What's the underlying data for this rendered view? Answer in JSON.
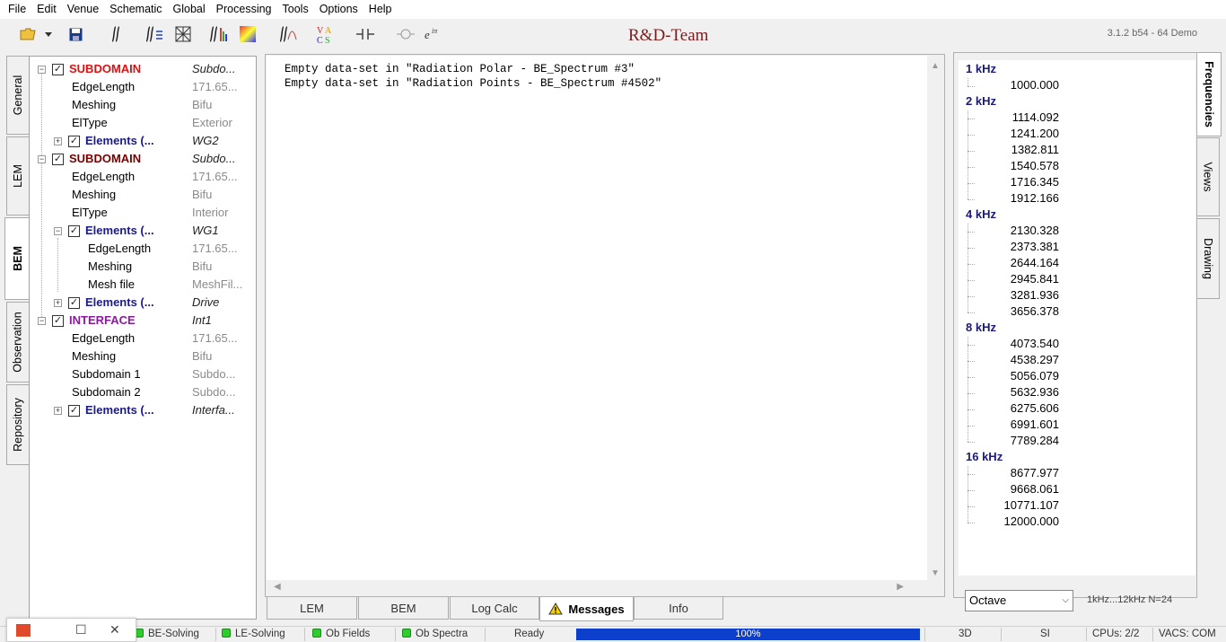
{
  "menu": [
    "File",
    "Edit",
    "Venue",
    "Schematic",
    "Global",
    "Processing",
    "Tools",
    "Options",
    "Help"
  ],
  "toolbar": {
    "app_title": "R&D-Team",
    "version": "3.1.2 b54 - 64 Demo",
    "vacs_label": "VA\nCS",
    "exp_label": "e^iπ"
  },
  "left_tabs": [
    "General",
    "LEM",
    "BEM",
    "Observation",
    "Repository"
  ],
  "right_tabs": [
    "Frequencies",
    "Views",
    "Drawing"
  ],
  "tree": [
    {
      "label": "SUBDOMAIN",
      "value": "Subdo...",
      "style": "subdomain"
    },
    {
      "label": "EdgeLength",
      "value": "171.65..."
    },
    {
      "label": "Meshing",
      "value": "Bifu"
    },
    {
      "label": "ElType",
      "value": "Exterior"
    },
    {
      "label": "Elements (...",
      "value": "WG2",
      "style": "elements"
    },
    {
      "label": "SUBDOMAIN",
      "value": "Subdo...",
      "style": "subdomain2"
    },
    {
      "label": "EdgeLength",
      "value": "171.65..."
    },
    {
      "label": "Meshing",
      "value": "Bifu"
    },
    {
      "label": "ElType",
      "value": "Interior"
    },
    {
      "label": "Elements (...",
      "value": "WG1",
      "style": "elements"
    },
    {
      "label": "EdgeLength",
      "value": "171.65..."
    },
    {
      "label": "Meshing",
      "value": "Bifu"
    },
    {
      "label": "Mesh file",
      "value": "MeshFil..."
    },
    {
      "label": "Elements (...",
      "value": "Drive",
      "style": "elements"
    },
    {
      "label": "INTERFACE",
      "value": "Int1",
      "style": "interface"
    },
    {
      "label": "EdgeLength",
      "value": "171.65..."
    },
    {
      "label": "Meshing",
      "value": "Bifu"
    },
    {
      "label": "Subdomain 1",
      "value": "Subdo..."
    },
    {
      "label": "Subdomain 2",
      "value": "Subdo..."
    },
    {
      "label": "Elements (...",
      "value": "Interfa...",
      "style": "elements"
    }
  ],
  "messages": [
    "Empty data-set in \"Radiation Polar - BE_Spectrum #3\"",
    "Empty data-set in \"Radiation Points - BE_Spectrum #4502\""
  ],
  "bottom_tabs": [
    "LEM",
    "BEM",
    "Log Calc",
    "Messages",
    "Info"
  ],
  "frequencies": [
    {
      "band": "1 kHz",
      "values": [
        "1000.000"
      ]
    },
    {
      "band": "2 kHz",
      "values": [
        "1114.092",
        "1241.200",
        "1382.811",
        "1540.578",
        "1716.345",
        "1912.166"
      ]
    },
    {
      "band": "4 kHz",
      "values": [
        "2130.328",
        "2373.381",
        "2644.164",
        "2945.841",
        "3281.936",
        "3656.378"
      ]
    },
    {
      "band": "8 kHz",
      "values": [
        "4073.540",
        "4538.297",
        "5056.079",
        "5632.936",
        "6275.606",
        "6991.601",
        "7789.284"
      ]
    },
    {
      "band": "16 kHz",
      "values": [
        "8677.977",
        "9668.061",
        "10771.107",
        "12000.000"
      ]
    }
  ],
  "octave_select": "Octave",
  "freq_range": "1kHz...12kHz   N=24",
  "status": {
    "be_solving": "BE-Solving",
    "le_solving": "LE-Solving",
    "ob_fields": "Ob Fields",
    "ob_spectra": "Ob Spectra",
    "ready": "Ready",
    "progress_percent": 100,
    "progress_label": "100%",
    "view": "3D",
    "units": "SI",
    "cpus": "CPUs: 2/2",
    "vacs": "VACS: COM"
  },
  "colors": {
    "subdomain": "#e01010",
    "subdomain2": "#7a0000",
    "interface": "#8b1aa0",
    "elements": "#1a1a8a",
    "progress": "#0c3fcc",
    "led": "#2ecc2e"
  }
}
